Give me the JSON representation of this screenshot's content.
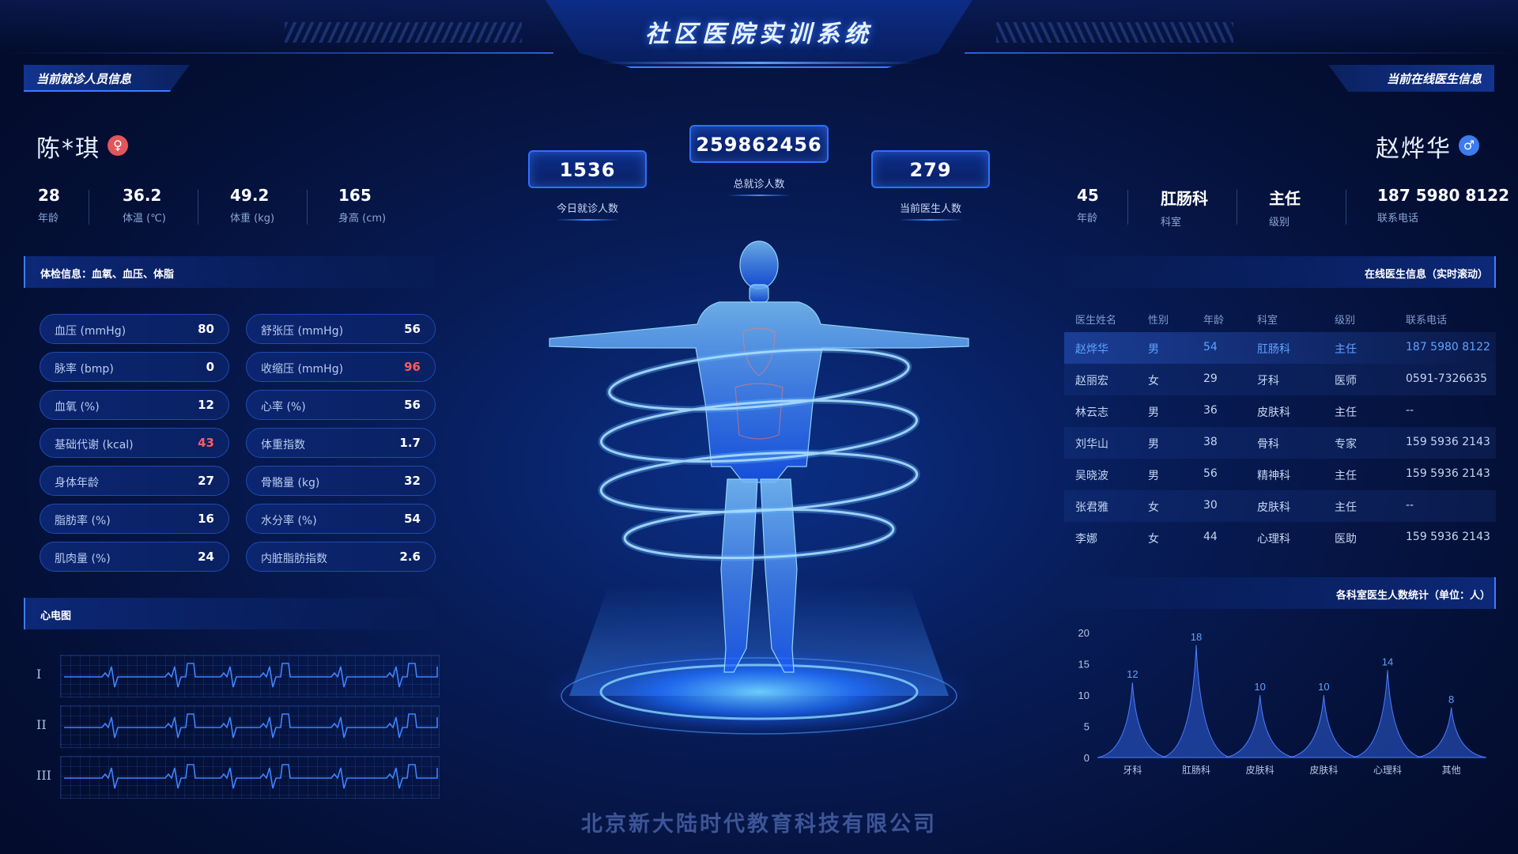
{
  "header": {
    "title": "社区医院实训系统"
  },
  "patient": {
    "section_title": "当前就诊人员信息",
    "name": "陈*琪",
    "gender_icon": "female-icon",
    "gender_glyph": "♀",
    "stats": [
      {
        "value": "28",
        "label": "年龄"
      },
      {
        "value": "36.2",
        "label": "体温 (℃)"
      },
      {
        "value": "49.2",
        "label": "体重 (kg)"
      },
      {
        "value": "165",
        "label": "身高 (cm)"
      }
    ],
    "exam_title": "体检信息：血氧、血压、体脂",
    "metrics_left": [
      {
        "label": "血压 (mmHg)",
        "value": "80",
        "alert": false
      },
      {
        "label": "脉率 (bmp)",
        "value": "0",
        "alert": false
      },
      {
        "label": "血氧 (%)",
        "value": "12",
        "alert": false
      },
      {
        "label": "基础代谢 (kcal)",
        "value": "43",
        "alert": true
      },
      {
        "label": "身体年龄",
        "value": "27",
        "alert": false
      },
      {
        "label": "脂肪率 (%)",
        "value": "16",
        "alert": false
      },
      {
        "label": "肌肉量 (%)",
        "value": "24",
        "alert": false
      }
    ],
    "metrics_right": [
      {
        "label": "舒张压 (mmHg)",
        "value": "56",
        "alert": false
      },
      {
        "label": "收缩压 (mmHg)",
        "value": "96",
        "alert": true
      },
      {
        "label": "心率 (%)",
        "value": "56",
        "alert": false
      },
      {
        "label": "体重指数",
        "value": "1.7",
        "alert": false
      },
      {
        "label": "骨骼量 (kg)",
        "value": "32",
        "alert": false
      },
      {
        "label": "水分率 (%)",
        "value": "54",
        "alert": false
      },
      {
        "label": "内脏脂肪指数",
        "value": "2.6",
        "alert": false
      }
    ],
    "ecg_title": "心电图",
    "ecg_leads": [
      "I",
      "II",
      "III"
    ]
  },
  "center": {
    "total": {
      "value": "259862456",
      "label": "总就诊人数"
    },
    "today": {
      "value": "1536",
      "label": "今日就诊人数"
    },
    "doctors": {
      "value": "279",
      "label": "当前医生人数"
    }
  },
  "doctor": {
    "section_title": "当前在线医生信息",
    "name": "赵烨华",
    "gender_icon": "male-icon",
    "gender_glyph": "♂",
    "stats": [
      {
        "value": "45",
        "label": "年龄"
      },
      {
        "value": "肛肠科",
        "label": "科室"
      },
      {
        "value": "主任",
        "label": "级别"
      },
      {
        "value": "187 5980 8122",
        "label": "联系电话"
      }
    ],
    "table_title": "在线医生信息（实时滚动）",
    "table_headers": [
      "医生姓名",
      "性别",
      "年龄",
      "科室",
      "级别",
      "联系电话"
    ],
    "table_rows": [
      [
        "赵烨华",
        "男",
        "54",
        "肛肠科",
        "主任",
        "187 5980 8122"
      ],
      [
        "赵丽宏",
        "女",
        "29",
        "牙科",
        "医师",
        "0591-7326635"
      ],
      [
        "林云志",
        "男",
        "36",
        "皮肤科",
        "主任",
        "--"
      ],
      [
        "刘华山",
        "男",
        "38",
        "骨科",
        "专家",
        "159 5936 2143"
      ],
      [
        "吴晓波",
        "男",
        "56",
        "精神科",
        "主任",
        "159 5936 2143"
      ],
      [
        "张君雅",
        "女",
        "30",
        "皮肤科",
        "主任",
        "--"
      ],
      [
        "李娜",
        "女",
        "44",
        "心理科",
        "医助",
        "159 5936 2143"
      ]
    ],
    "chart_title": "各科室医生人数统计（单位：人）"
  },
  "chart_data": {
    "type": "area",
    "title": "各科室医生人数统计（单位：人）",
    "categories": [
      "牙科",
      "肛肠科",
      "皮肤科",
      "皮肤科",
      "心理科",
      "其他"
    ],
    "values": [
      12,
      18,
      10,
      10,
      14,
      8
    ],
    "ylim": [
      0,
      20
    ],
    "yticks": [
      0,
      5,
      10,
      15,
      20
    ],
    "color": "#2f5fd8"
  },
  "footer": {
    "company": "北京新大陆时代教育科技有限公司"
  },
  "colors": {
    "accent": "#3c7dff",
    "alert": "#ff5a5f",
    "selected": "#5fa3ff"
  }
}
